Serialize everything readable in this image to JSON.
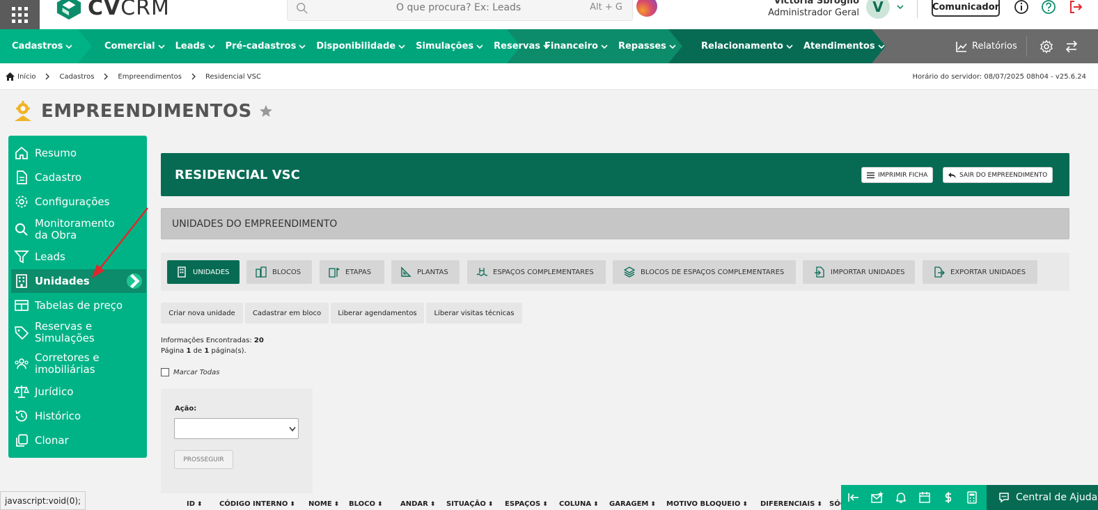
{
  "app": {
    "logo_bold": "CV",
    "logo_light": "CRM"
  },
  "search": {
    "placeholder": "O que procura? Ex: Leads",
    "shortcut": "Alt + G"
  },
  "user": {
    "name": "Victoria Sbroglio",
    "role": "Administrador Geral",
    "initial": "V"
  },
  "header": {
    "comunicador_label": "Comunicador"
  },
  "nav": {
    "cadastros": "Cadastros",
    "items_a": [
      "Comercial",
      "Leads",
      "Pré-cadastros",
      "Disponibilidade",
      "Simulações",
      "Reservas"
    ],
    "items_b": [
      "Financeiro",
      "Repasses"
    ],
    "items_c": [
      "Relacionamento",
      "Atendimentos"
    ],
    "relatorios": "Relatórios"
  },
  "breadcrumb": [
    "Início",
    "Cadastros",
    "Empreendimentos",
    "Residencial VSC"
  ],
  "server_time": "Horário do servidor: 08/07/2025 08h04 - v25.6.24",
  "page_title": "EMPREENDIMENTOS",
  "sidebar": {
    "items": [
      {
        "label": "Resumo",
        "icon": "home-icon"
      },
      {
        "label": "Cadastro",
        "icon": "document-icon"
      },
      {
        "label": "Configurações",
        "icon": "gear-icon"
      },
      {
        "label": "Monitoramento da Obra",
        "icon": "search-icon"
      },
      {
        "label": "Leads",
        "icon": "filter-icon"
      },
      {
        "label": "Unidades",
        "icon": "building-icon"
      },
      {
        "label": "Tabelas de preço",
        "icon": "table-icon"
      },
      {
        "label": "Reservas e Simulações",
        "icon": "tag-icon"
      },
      {
        "label": "Corretores e imobiliárias",
        "icon": "users-icon"
      },
      {
        "label": "Jurídico",
        "icon": "scale-icon"
      },
      {
        "label": "Histórico",
        "icon": "history-icon"
      },
      {
        "label": "Clonar",
        "icon": "copy-icon"
      }
    ],
    "active": "Unidades"
  },
  "project": {
    "name": "RESIDENCIAL VSC",
    "print_label": "IMPRIMIR FICHA",
    "exit_label": "SAIR DO EMPREENDIMENTO"
  },
  "section_title": "UNIDADES DO EMPREENDIMENTO",
  "tabs": [
    "UNIDADES",
    "BLOCOS",
    "ETAPAS",
    "PLANTAS",
    "ESPAÇOS COMPLEMENTARES",
    "BLOCOS DE ESPAÇOS COMPLEMENTARES",
    "IMPORTAR UNIDADES",
    "EXPORTAR UNIDADES"
  ],
  "actions": [
    "Criar nova unidade",
    "Cadastrar em bloco",
    "Liberar agendamentos",
    "Liberar visitas técnicas"
  ],
  "results": {
    "found_label": "Informações Encontradas:",
    "found_count": "20",
    "page_prefix": "Página",
    "page_current": "1",
    "page_of": "de",
    "page_total": "1",
    "page_suffix": "página(s)."
  },
  "mark_all_label": "Marcar Todas",
  "action_panel": {
    "label": "Ação:",
    "selected": "",
    "submit_label": "PROSSEGUIR"
  },
  "table_columns": [
    "ID",
    "CÓDIGO INTERNO",
    "NOME",
    "BLOCO",
    "ANDAR",
    "SITUAÇÃO",
    "ESPAÇOS",
    "COLUNA",
    "GARAGEM",
    "MOTIVO BLOQUEIO",
    "DIFERENCIAIS",
    "SÓC"
  ],
  "status_url": "javascript:void(0);",
  "help_label": "Central de Ajuda",
  "colors": {
    "brand_green": "#00b386",
    "dark_green": "#076b54",
    "nav_gray": "#6b6b6b",
    "accent_red": "#e0282c"
  }
}
